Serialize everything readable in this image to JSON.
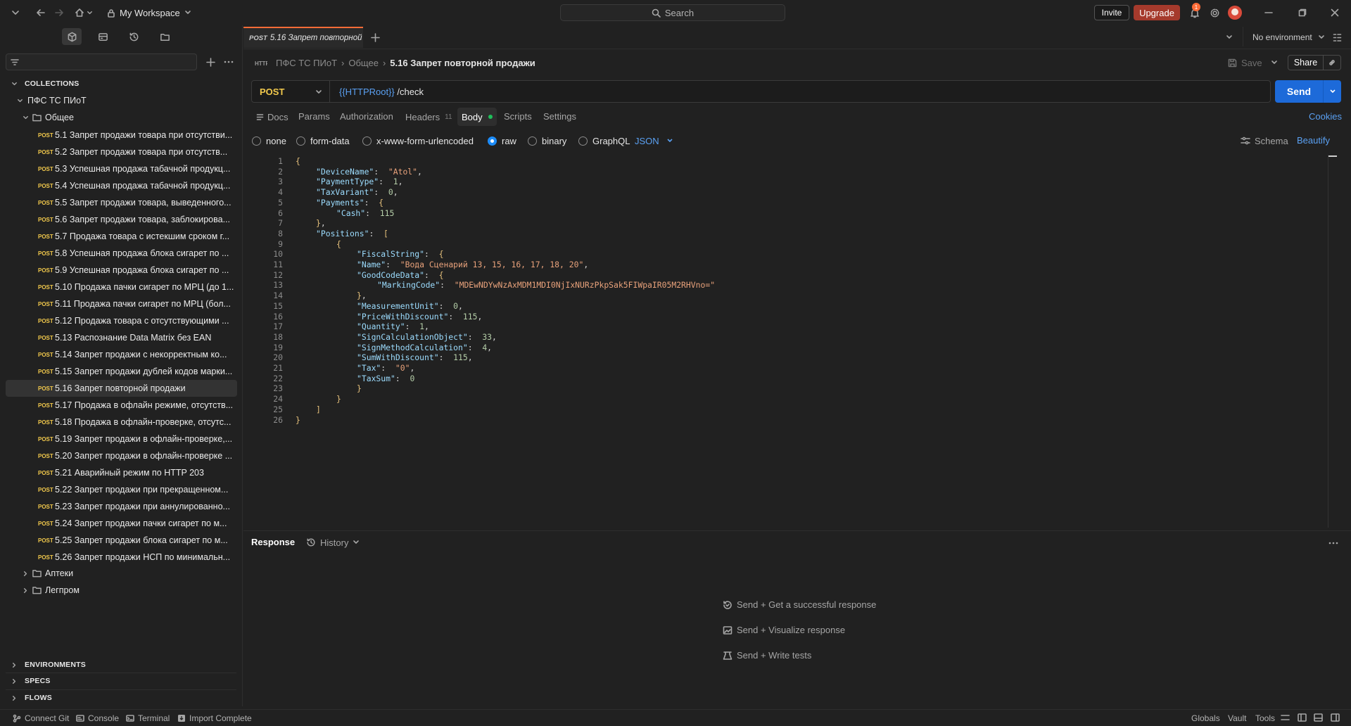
{
  "titlebar": {
    "workspace": "My Workspace",
    "search_placeholder": "Search",
    "invite": "Invite",
    "upgrade": "Upgrade",
    "notification_count": "1"
  },
  "sidebar": {
    "collections_label": "COLLECTIONS",
    "collection_name": "ПФС ТС ПИоТ",
    "folder_open": "Общее",
    "method": "POST",
    "requests": [
      "5.1 Запрет продажи товара при отсутстви...",
      "5.2 Запрет продажи товара при отсутств...",
      "5.3 Успешная продажа табачной продукц...",
      "5.4 Успешная продажа табачной продукц...",
      "5.5 Запрет продажи товара, выведенного...",
      "5.6 Запрет продажи товара, заблокирова...",
      "5.7 Продажа товара с истекшим сроком г...",
      "5.8 Успешная продажа блока сигарет по ...",
      "5.9 Успешная продажа блока сигарет по ...",
      "5.10 Продажа пачки сигарет по МРЦ (до 1...",
      "5.11 Продажа пачки сигарет по МРЦ (бол...",
      "5.12 Продажа товара с отсутствующими ...",
      "5.13 Распознание Data Matrix без EAN",
      "5.14 Запрет продажи с некорректным ко...",
      "5.15 Запрет продажи дублей кодов марки...",
      "5.16 Запрет повторной продажи",
      "5.17 Продажа в офлайн режиме, отсутств...",
      "5.18 Продажа в офлайн-проверке, отсутс...",
      "5.19 Запрет продажи в офлайн-проверке,...",
      "5.20 Запрет продажи в офлайн-проверке ...",
      "5.21 Аварийный режим по HTTP 203",
      "5.22 Запрет продажи при прекращенном...",
      "5.23 Запрет продажи при аннулированно...",
      "5.24 Запрет продажи пачки сигарет по м...",
      "5.25 Запрет продажи блока сигарет по м...",
      "5.26 Запрет продажи НСП по минимальн..."
    ],
    "selected_index": 15,
    "folders_closed": [
      "Аптеки",
      "Легпром"
    ],
    "bottom_sections": [
      "ENVIRONMENTS",
      "SPECS",
      "FLOWS"
    ]
  },
  "tabbar": {
    "tab_method": "POST",
    "tab_title": "5.16 Запрет повторной",
    "environment": "No environment"
  },
  "request": {
    "breadcrumb": [
      "ПФС ТС ПИоТ",
      "Общее",
      "5.16 Запрет повторной продажи"
    ],
    "save": "Save",
    "share": "Share",
    "method": "POST",
    "url_var": "{{HTTPRoot}}",
    "url_path": " /check",
    "send": "Send",
    "tabs": {
      "docs": "Docs",
      "params": "Params",
      "authorization": "Authorization",
      "headers": "Headers",
      "headers_count": "11",
      "body": "Body",
      "scripts": "Scripts",
      "settings": "Settings"
    },
    "cookies": "Cookies",
    "body_types": {
      "none": "none",
      "form_data": "form-data",
      "urlencoded": "x-www-form-urlencoded",
      "raw": "raw",
      "binary": "binary",
      "graphql": "GraphQL"
    },
    "raw_format": "JSON",
    "schema": "Schema",
    "beautify": "Beautify"
  },
  "editor": {
    "line_numbers": [
      "1",
      "2",
      "3",
      "4",
      "5",
      "6",
      "7",
      "8",
      "9",
      "10",
      "11",
      "12",
      "13",
      "14",
      "15",
      "16",
      "17",
      "18",
      "19",
      "20",
      "21",
      "22",
      "23",
      "24",
      "25",
      "26"
    ]
  },
  "body_json": {
    "DeviceName": "Atol",
    "PaymentType": "1",
    "TaxVariant": "0",
    "Cash": "115",
    "FiscalString": "",
    "Name": "Вода Сценарий 13, 15, 16, 17, 18, 20",
    "MarkingCode": "MDEwNDYwNzAxMDM1MDI0NjIxNURzPkpSak5FIWpaIR05M2RHVno=",
    "MeasurementUnit": "0",
    "PriceWithDiscount": "115",
    "Quantity": "1",
    "SignCalculationObject": "33",
    "SignMethodCalculation": "4",
    "SumWithDiscount": "115",
    "Tax": "0",
    "TaxSum": "0"
  },
  "response": {
    "title": "Response",
    "history": "History",
    "hints": [
      "Send + Get a successful response",
      "Send + Visualize response",
      "Send + Write tests"
    ]
  },
  "statusbar": {
    "connect_git": "Connect Git",
    "console": "Console",
    "terminal": "Terminal",
    "import": "Import Complete",
    "globals": "Globals",
    "vault": "Vault",
    "tools": "Tools"
  },
  "colors": {
    "accent": "#ff6c37",
    "send": "#1d6ad9",
    "post": "#f2c94c",
    "upgrade": "#a53a2c"
  }
}
